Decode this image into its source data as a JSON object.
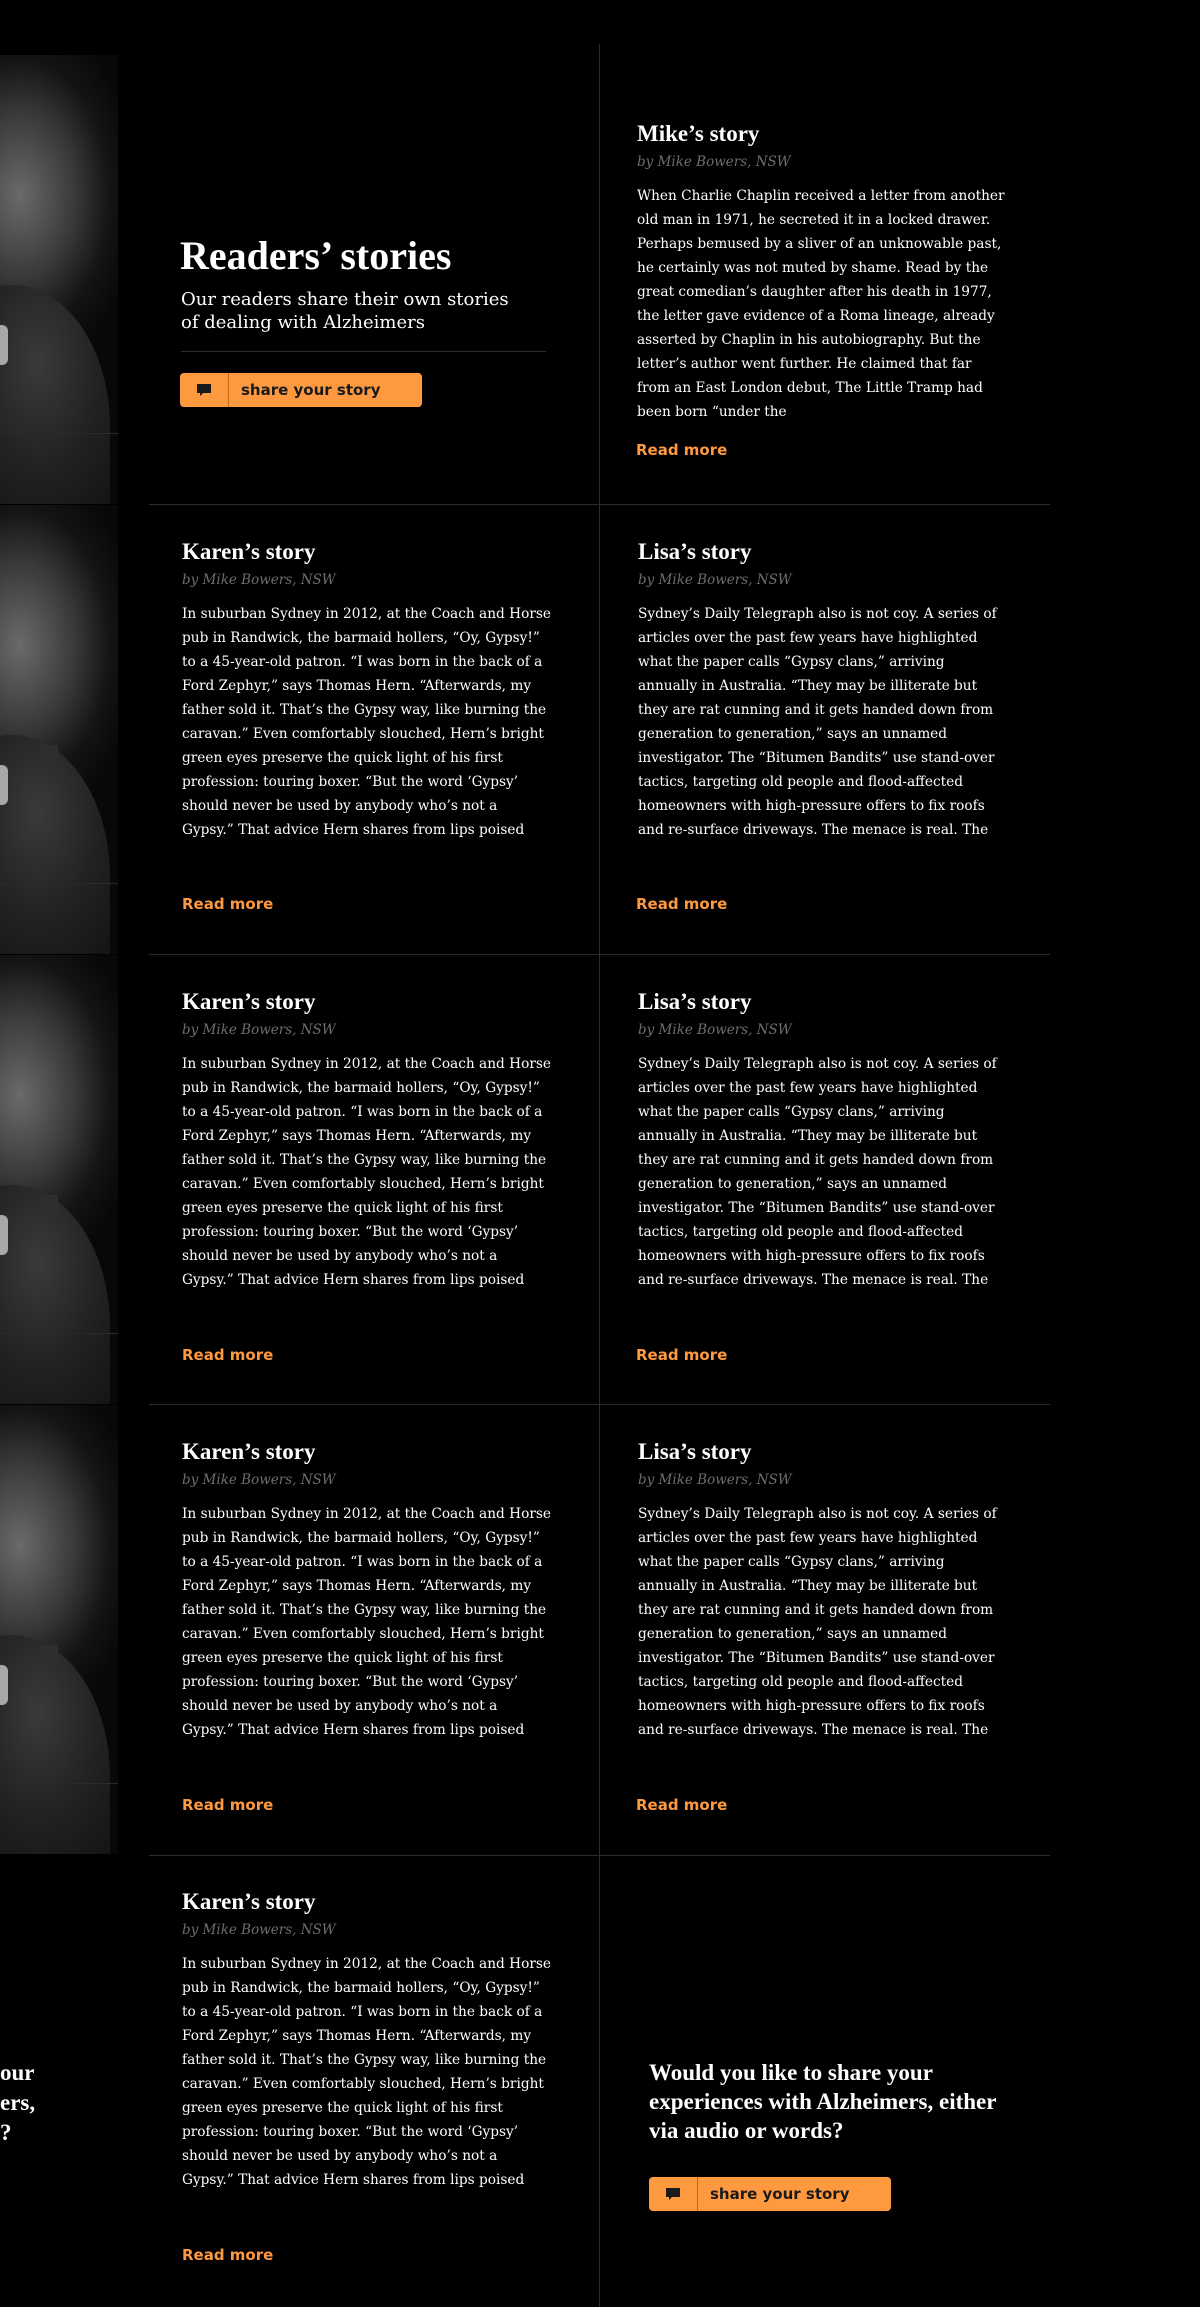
{
  "intro": {
    "title": "Readers’ stories",
    "subtitle": "Our readers share their own stories of dealing with Alzheimers",
    "share_label": "share your story",
    "share_icon": "speech-bubble-icon"
  },
  "read_more_label": "Read more",
  "stories": [
    {
      "title": "Mike’s story",
      "byline": "by Mike Bowers, NSW",
      "body": "When Charlie Chaplin received a letter from another old man in 1971, he secreted it in a locked drawer. Perhaps bemused by a sliver of an unknowable past, he certainly was not muted by shame. Read by the great comedian’s daughter after his death in 1977, the letter gave evidence of a Roma lineage, already asserted by Chaplin in his autobiography. But the letter’s author went further. He claimed that far from an East London debut, The Little Tramp had been born “under the"
    },
    {
      "title": "Karen’s story",
      "byline": "by Mike Bowers, NSW",
      "body": "In suburban Sydney in 2012, at the Coach and Horse pub in Randwick, the barmaid hollers, “Oy, Gypsy!” to a 45-year-old patron. “I was born in the back of a Ford Zephyr,” says Thomas Hern. “Afterwards, my father sold it. That’s the Gypsy way, like burning the caravan.” Even comfortably slouched, Hern’s bright green eyes preserve the quick light of his first profession: touring boxer. “But the word ‘Gypsy’ should never be used by anybody who’s not a Gypsy.” That advice Hern shares from lips poised above a"
    },
    {
      "title": "Lisa’s story",
      "byline": "by Mike Bowers, NSW",
      "body": "Sydney’s Daily Telegraph also is not coy. A series of articles over the past few years have highlighted what the paper calls “Gypsy clans,” arriving annually in Australia. “They may be illiterate but they are rat cunning and it gets handed down from generation to generation,” says an unnamed investigator. The “Bitumen Bandits” use stand-over tactics, targeting old people and flood-affected homeowners with high-pressure offers to fix roofs and re-surface driveways. The menace is real. The gangs, some with records for"
    },
    {
      "title": "Karen’s story",
      "byline": "by Mike Bowers, NSW",
      "body": "In suburban Sydney in 2012, at the Coach and Horse pub in Randwick, the barmaid hollers, “Oy, Gypsy!” to a 45-year-old patron. “I was born in the back of a Ford Zephyr,” says Thomas Hern. “Afterwards, my father sold it. That’s the Gypsy way, like burning the caravan.” Even comfortably slouched, Hern’s bright green eyes preserve the quick light of his first profession: touring boxer. “But the word ‘Gypsy’ should never be used by anybody who’s not a Gypsy.” That advice Hern shares from lips poised above a"
    },
    {
      "title": "Lisa’s story",
      "byline": "by Mike Bowers, NSW",
      "body": "Sydney’s Daily Telegraph also is not coy. A series of articles over the past few years have highlighted what the paper calls “Gypsy clans,” arriving annually in Australia. “They may be illiterate but they are rat cunning and it gets handed down from generation to generation,” says an unnamed investigator. The “Bitumen Bandits” use stand-over tactics, targeting old people and flood-affected homeowners with high-pressure offers to fix roofs and re-surface driveways. The menace is real. The gangs, some with records for"
    },
    {
      "title": "Karen’s story",
      "byline": "by Mike Bowers, NSW",
      "body": "In suburban Sydney in 2012, at the Coach and Horse pub in Randwick, the barmaid hollers, “Oy, Gypsy!” to a 45-year-old patron. “I was born in the back of a Ford Zephyr,” says Thomas Hern. “Afterwards, my father sold it. That’s the Gypsy way, like burning the caravan.” Even comfortably slouched, Hern’s bright green eyes preserve the quick light of his first profession: touring boxer. “But the word ‘Gypsy’ should never be used by anybody who’s not a Gypsy.” That advice Hern shares from lips poised above a"
    },
    {
      "title": "Lisa’s story",
      "byline": "by Mike Bowers, NSW",
      "body": "Sydney’s Daily Telegraph also is not coy. A series of articles over the past few years have highlighted what the paper calls “Gypsy clans,” arriving annually in Australia. “They may be illiterate but they are rat cunning and it gets handed down from generation to generation,” says an unnamed investigator. The “Bitumen Bandits” use stand-over tactics, targeting old people and flood-affected homeowners with high-pressure offers to fix roofs and re-surface driveways. The menace is real. The gangs, some with records for"
    },
    {
      "title": "Karen’s story",
      "byline": "by Mike Bowers, NSW",
      "body": "In suburban Sydney in 2012, at the Coach and Horse pub in Randwick, the barmaid hollers, “Oy, Gypsy!” to a 45-year-old patron. “I was born in the back of a Ford Zephyr,” says Thomas Hern. “Afterwards, my father sold it. That’s the Gypsy way, like burning the caravan.” Even comfortably slouched, Hern’s bright green eyes preserve the quick light of his first profession: touring boxer. “But the word ‘Gypsy’ should never be used by anybody who’s not a Gypsy.” That advice Hern shares from lips poised above a"
    }
  ],
  "cta": {
    "question": "Would you like to share your experiences with Alzheimers, either via audio or words?",
    "share_label": "share your story",
    "share_icon": "speech-bubble-icon"
  },
  "left_cutoff_text": "our\ners,\n?",
  "colors": {
    "background": "#000000",
    "accent": "#ff9940",
    "byline": "#6e6e6e",
    "divider": "#2b2b2b"
  }
}
